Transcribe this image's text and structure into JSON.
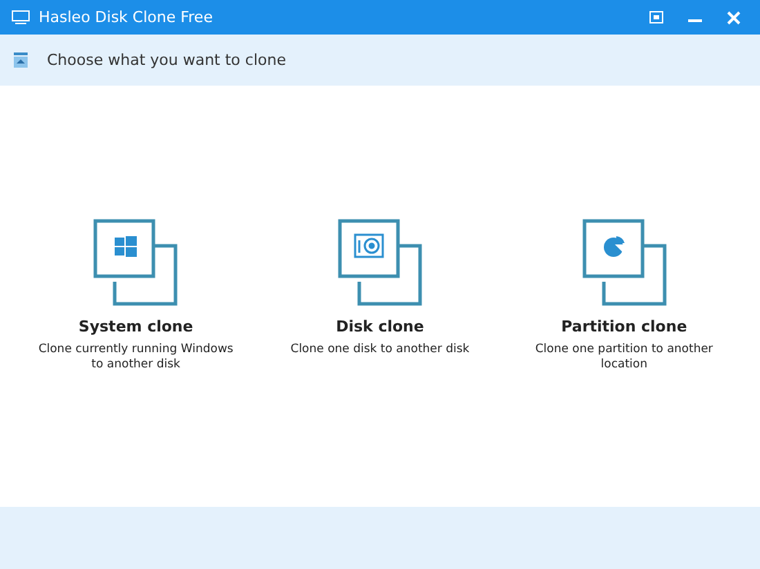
{
  "window": {
    "title": "Hasleo Disk Clone Free"
  },
  "header": {
    "title": "Choose what you want to clone"
  },
  "options": [
    {
      "kind": "system",
      "title": "System clone",
      "description": "Clone currently running Windows to another disk"
    },
    {
      "kind": "disk",
      "title": "Disk clone",
      "description": "Clone one disk to another disk"
    },
    {
      "kind": "partition",
      "title": "Partition clone",
      "description": "Clone one partition to another location"
    }
  ]
}
